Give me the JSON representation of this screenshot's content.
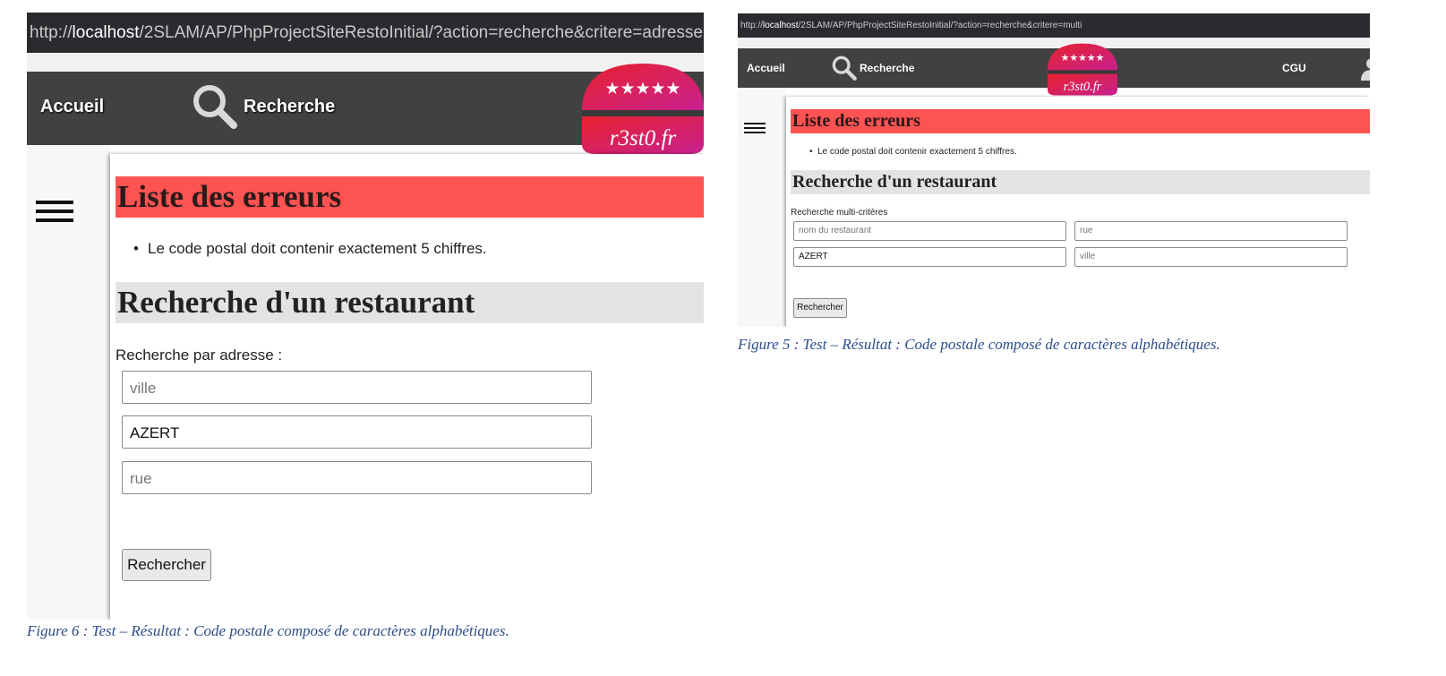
{
  "figure6": {
    "url_prefix": "http://",
    "url_host": "localhost",
    "url_path": "/2SLAM/AP/PhpProjectSiteRestoInitial/?action=recherche&critere=adresse",
    "nav": {
      "home_label": "Accueil",
      "search_label": "Recherche"
    },
    "logo_text": "r3st0.fr",
    "logo_stars": "★★★★★",
    "errors_title": "Liste des erreurs",
    "errors": [
      "Le code postal doit contenir exactement 5 chiffres."
    ],
    "section_title": "Recherche d'un restaurant",
    "search_label": "Recherche par adresse :",
    "fields": {
      "ville_placeholder": "ville",
      "cp_value": "AZERT",
      "rue_placeholder": "rue"
    },
    "submit_label": "Rechercher",
    "caption": "Figure 6 : Test – Résultat : Code postale composé de caractères alphabétiques."
  },
  "figure5": {
    "url_prefix": "http://",
    "url_host": "localhost",
    "url_path": "/2SLAM/AP/PhpProjectSiteRestoInitial/?action=recherche&critere=multi",
    "nav": {
      "home_label": "Accueil",
      "search_label": "Recherche",
      "cgu_label": "CGU"
    },
    "logo_text": "r3st0.fr",
    "logo_stars": "★★★★★",
    "errors_title": "Liste des erreurs",
    "errors": [
      "Le code postal doit contenir exactement 5 chiffres."
    ],
    "section_title": "Recherche d'un restaurant",
    "search_label": "Recherche multi-critères",
    "fields": {
      "nom_placeholder": "nom du restaurant",
      "rue_placeholder": "rue",
      "cp_value": "AZERT",
      "ville_placeholder": "ville"
    },
    "submit_label": "Rechercher",
    "caption": "Figure 5 : Test – Résultat : Code postale composé de caractères alphabétiques."
  },
  "colors": {
    "error_banner": "#fd5352",
    "section_banner": "#e3e3e3",
    "navbar": "#414141",
    "url_bar": "#2a2b2f",
    "caption": "#2b4d87",
    "logo_gradient_start": "#e8212e",
    "logo_gradient_end": "#c8218f"
  }
}
